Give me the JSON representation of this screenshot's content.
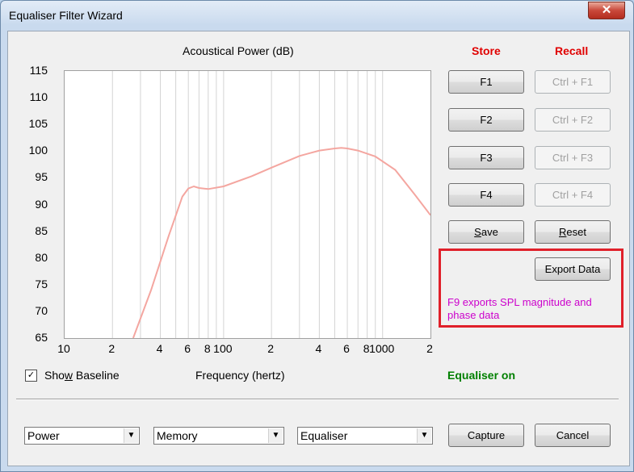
{
  "window": {
    "title": "Equaliser Filter Wizard",
    "close_glyph": "✕"
  },
  "chart_data": {
    "type": "line",
    "title": "Acoustical Power (dB)",
    "xlabel": "Frequency (hertz)",
    "ylabel": "",
    "x_scale": "log",
    "xlim": [
      10,
      2000
    ],
    "ylim": [
      65,
      115
    ],
    "yticks": [
      "115",
      "110",
      "105",
      "100",
      "95",
      "90",
      "85",
      "80",
      "75",
      "70",
      "65"
    ],
    "xtick_labels": [
      {
        "v": 10,
        "t": "10"
      },
      {
        "v": 20,
        "t": "2"
      },
      {
        "v": 40,
        "t": "4"
      },
      {
        "v": 60,
        "t": "6"
      },
      {
        "v": 80,
        "t": "8"
      },
      {
        "v": 100,
        "t": "100"
      },
      {
        "v": 200,
        "t": "2"
      },
      {
        "v": 400,
        "t": "4"
      },
      {
        "v": 600,
        "t": "6"
      },
      {
        "v": 800,
        "t": "8"
      },
      {
        "v": 1000,
        "t": "1000"
      },
      {
        "v": 2000,
        "t": "2"
      }
    ],
    "grid": true,
    "series": [
      {
        "color": "#f4a6a0",
        "x": [
          27,
          35,
          45,
          55,
          60,
          65,
          70,
          80,
          100,
          150,
          200,
          300,
          400,
          500,
          550,
          600,
          700,
          900,
          1200,
          1600,
          2000
        ],
        "y": [
          65,
          74,
          84,
          91.5,
          93,
          93.4,
          93.1,
          92.9,
          93.4,
          95.3,
          96.9,
          99.1,
          100.1,
          100.5,
          100.6,
          100.5,
          100.1,
          99,
          96.5,
          91.8,
          88
        ]
      }
    ]
  },
  "checkbox": {
    "label_pre": "Sho",
    "label_u": "w",
    "label_post": " Baseline",
    "checked": true,
    "mark": "✓"
  },
  "panel": {
    "store_label": "Store",
    "recall_label": "Recall",
    "store_color": "#e00000",
    "f1": "F1",
    "f2": "F2",
    "f3": "F3",
    "f4": "F4",
    "ctrl_f1": "Ctrl + F1",
    "ctrl_f2": "Ctrl + F2",
    "ctrl_f3": "Ctrl + F3",
    "ctrl_f4": "Ctrl + F4",
    "save_u": "S",
    "save_rest": "ave",
    "reset_u": "R",
    "reset_rest": "eset",
    "export_label": "Export Data",
    "export_note": "F9 exports SPL magnitude and phase data",
    "note_color": "#cc00cc",
    "equaliser_status": "Equaliser on",
    "status_color": "#008000"
  },
  "bottom": {
    "select_power": "Power",
    "select_memory": "Memory",
    "select_equaliser": "Equaliser",
    "capture_label": "Capture",
    "cancel_label": "Cancel",
    "arrow_glyph": "▼"
  }
}
